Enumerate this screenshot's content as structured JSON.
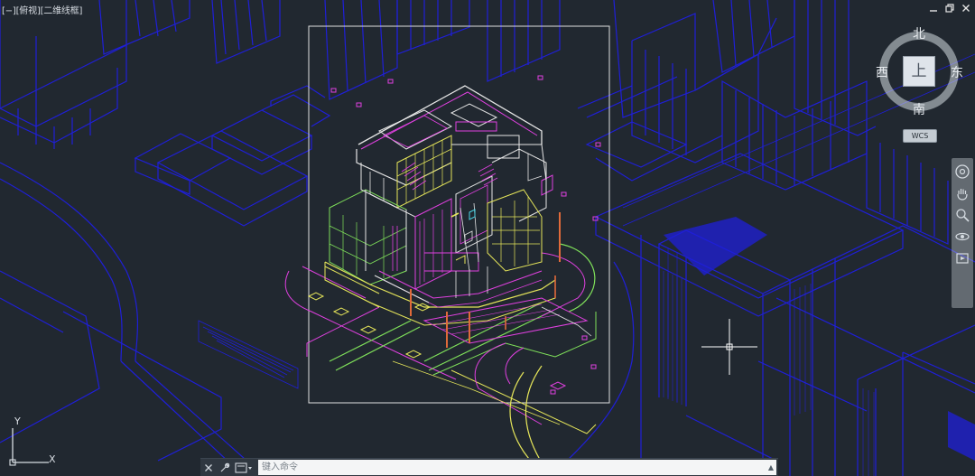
{
  "viewport": {
    "control": "[−]",
    "view": "[俯视]",
    "style": "[二维线框]"
  },
  "window_controls": {
    "minimize_icon": "minimize-icon",
    "restore_icon": "restore-icon",
    "close_icon": "close-icon"
  },
  "viewcube": {
    "face": "上",
    "north": "北",
    "south": "南",
    "west": "西",
    "east": "东",
    "wcs": "WCS"
  },
  "navbar": {
    "items": [
      "steering-wheel-icon",
      "pan-icon",
      "zoom-icon",
      "orbit-icon",
      "showmotion-icon"
    ]
  },
  "ucs": {
    "y": "Y",
    "x": "X"
  },
  "command_line": {
    "close_icon": "close-icon",
    "customize_icon": "wrench-icon",
    "recent_icon": "command-history-icon",
    "placeholder": "键入命令"
  },
  "colors": {
    "background": "#212830",
    "context_lines": "#1a1ad6",
    "building_white": "#e6e6e6",
    "building_magenta": "#e040e0",
    "building_yellow": "#e6e65a",
    "building_green": "#7fe05a",
    "building_red": "#e06a3a",
    "plot_frame": "#e6e6e6"
  }
}
